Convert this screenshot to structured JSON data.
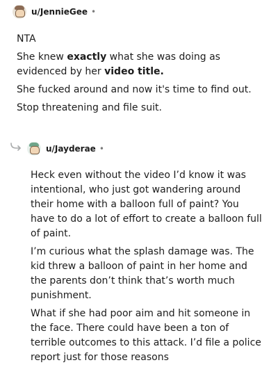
{
  "comments": [
    {
      "username": "u/JennieGee",
      "separator": "•",
      "paragraphs": [
        {
          "parts": [
            {
              "t": "NTA"
            }
          ]
        },
        {
          "parts": [
            {
              "t": "She knew "
            },
            {
              "t": "exactly",
              "b": true
            },
            {
              "t": " what she was doing as evidenced by her "
            },
            {
              "t": "video title.",
              "b": true
            }
          ]
        },
        {
          "parts": [
            {
              "t": "She fucked around and now it's time to find out."
            }
          ]
        },
        {
          "parts": [
            {
              "t": "Stop threatening and file suit."
            }
          ]
        }
      ]
    },
    {
      "username": "u/Jayderae",
      "separator": "•",
      "paragraphs": [
        {
          "parts": [
            {
              "t": "Heck even without the video I’d know it was intentional, who just got wandering around their home with a balloon full of paint? You have to do a lot of effort to create a balloon full of paint."
            }
          ]
        },
        {
          "parts": [
            {
              "t": "I’m curious what the splash damage was. The kid threw a balloon of paint in her home and the parents don’t think that’s worth much punishment."
            }
          ]
        },
        {
          "parts": [
            {
              "t": "What if she had poor aim and hit someone in the face. There could have been a ton of terrible outcomes to this attack. I’d file a police report just for those reasons"
            }
          ]
        }
      ]
    }
  ]
}
